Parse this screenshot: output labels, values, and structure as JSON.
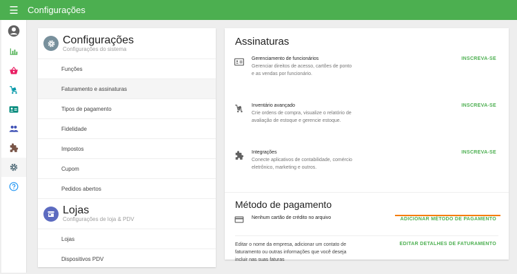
{
  "app": {
    "title": "Configurações",
    "accent": "#4caf50"
  },
  "rail": {
    "items": [
      {
        "icon": "account-icon",
        "color": "#616161"
      },
      {
        "icon": "bar-chart-icon",
        "color": "#4caf50"
      },
      {
        "icon": "basket-icon",
        "color": "#e91e63"
      },
      {
        "icon": "cart-icon",
        "color": "#0097a7"
      },
      {
        "icon": "id-card-icon",
        "color": "#00897b"
      },
      {
        "icon": "people-icon",
        "color": "#3f51b5"
      },
      {
        "icon": "puzzle-icon",
        "color": "#795548"
      },
      {
        "icon": "gear-icon",
        "color": "#546e7a"
      },
      {
        "icon": "help-icon",
        "color": "#2196f3"
      }
    ]
  },
  "settings": {
    "title": "Configurações",
    "subtitle": "Configurações do sistema",
    "items": [
      "Funções",
      "Faturamento e assinaturas",
      "Tipos de pagamento",
      "Fidelidade",
      "Impostos",
      "Cupom",
      "Pedidos abertos"
    ]
  },
  "stores": {
    "title": "Lojas",
    "subtitle": "Configurações de loja & PDV",
    "items": [
      "Lojas",
      "Dispositivos PDV"
    ]
  },
  "subscriptions": {
    "title": "Assinaturas",
    "rows": [
      {
        "title": "Gerenciamento de funcionários",
        "desc": "Gerenciar direitos de acesso, cartões de ponto e as vendas por funcionário.",
        "action": "INSCREVA-SE"
      },
      {
        "title": "Inventário avançado",
        "desc": "Crie ordens de compra, visualize o relatório de avaliação de estoque e gerencie estoque.",
        "action": "INSCREVA-SE"
      },
      {
        "title": "Integrações",
        "desc": "Conecte aplicativos de contabilidade, comércio eletrônico, marketing e outros.",
        "action": "INSCREVA-SE"
      }
    ]
  },
  "payment": {
    "title": "Método de pagamento",
    "card_text": "Nenhum cartão de crédito no arquivo",
    "add_action": "ADICIONAR MÉTODO DE PAGAMENTO",
    "billing_text": "Editar o nome da empresa, adicionar um contato de faturamento ou outras informações que você deseja incluir nas suas faturas",
    "billing_action": "EDITAR DETALHES DE FATURAMENTO"
  }
}
